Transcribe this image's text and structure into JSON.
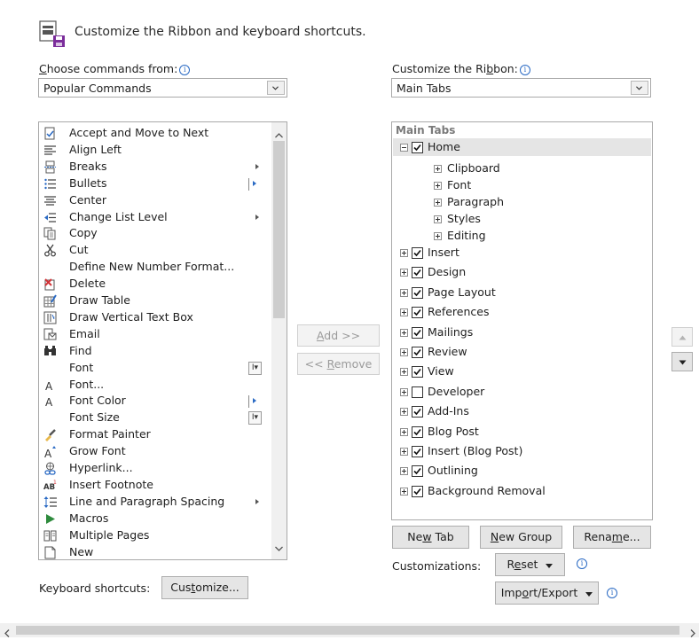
{
  "header": {
    "title": "Customize the Ribbon and keyboard shortcuts.",
    "icon": "ribbon-save-icon"
  },
  "left": {
    "choose_label_first": "C",
    "choose_label_rest": "hoose commands from:",
    "combo_value": "Popular Commands",
    "commands": [
      {
        "label": "Accept and Move to Next",
        "icon": "accept-icon"
      },
      {
        "label": "Align Left",
        "icon": "align-left-icon"
      },
      {
        "label": "Breaks",
        "icon": "breaks-icon",
        "submenu": true
      },
      {
        "label": "Bullets",
        "icon": "bullets-icon",
        "split": true
      },
      {
        "label": "Center",
        "icon": "center-icon"
      },
      {
        "label": "Change List Level",
        "icon": "change-list-level-icon",
        "submenu": true
      },
      {
        "label": "Copy",
        "icon": "copy-icon"
      },
      {
        "label": "Cut",
        "icon": "cut-icon"
      },
      {
        "label": "Define New Number Format...",
        "icon": ""
      },
      {
        "label": "Delete",
        "icon": "delete-icon"
      },
      {
        "label": "Draw Table",
        "icon": "draw-table-icon"
      },
      {
        "label": "Draw Vertical Text Box",
        "icon": "vertical-text-box-icon"
      },
      {
        "label": "Email",
        "icon": "email-icon"
      },
      {
        "label": "Find",
        "icon": "find-icon"
      },
      {
        "label": "Font",
        "icon": "",
        "fontsel": true
      },
      {
        "label": "Font...",
        "icon": "font-dialog-icon"
      },
      {
        "label": "Font Color",
        "icon": "font-color-icon",
        "split": true
      },
      {
        "label": "Font Size",
        "icon": "",
        "fontsel": true
      },
      {
        "label": "Format Painter",
        "icon": "format-painter-icon"
      },
      {
        "label": "Grow Font",
        "icon": "grow-font-icon"
      },
      {
        "label": "Hyperlink...",
        "icon": "hyperlink-icon"
      },
      {
        "label": "Insert Footnote",
        "icon": "footnote-icon"
      },
      {
        "label": "Line and Paragraph Spacing",
        "icon": "line-spacing-icon",
        "submenu": true
      },
      {
        "label": "Macros",
        "icon": "macros-icon"
      },
      {
        "label": "Multiple Pages",
        "icon": "multiple-pages-icon"
      },
      {
        "label": "New",
        "icon": "new-document-icon"
      }
    ],
    "keyboard_label": "Keyboard shortcuts:",
    "customize_button_pre": "Cus",
    "customize_button_u": "t",
    "customize_button_post": "omize..."
  },
  "middle": {
    "add_u": "A",
    "add_rest": "dd >>",
    "remove_pre": "<< ",
    "remove_u": "R",
    "remove_rest": "emove"
  },
  "right": {
    "customize_label_pre": "Customize the Ri",
    "customize_label_u": "b",
    "customize_label_post": "bon:",
    "combo_value": "Main Tabs",
    "tree_header": "Main Tabs",
    "home": {
      "label": "Home",
      "checked": true,
      "expanded": true
    },
    "home_groups": [
      "Clipboard",
      "Font",
      "Paragraph",
      "Styles",
      "Editing"
    ],
    "tabs": [
      {
        "label": "Insert",
        "checked": true
      },
      {
        "label": "Design",
        "checked": true
      },
      {
        "label": "Page Layout",
        "checked": true
      },
      {
        "label": "References",
        "checked": true
      },
      {
        "label": "Mailings",
        "checked": true
      },
      {
        "label": "Review",
        "checked": true
      },
      {
        "label": "View",
        "checked": true
      },
      {
        "label": "Developer",
        "checked": false
      },
      {
        "label": "Add-Ins",
        "checked": true
      },
      {
        "label": "Blog Post",
        "checked": true
      },
      {
        "label": "Insert (Blog Post)",
        "checked": true
      },
      {
        "label": "Outlining",
        "checked": true
      },
      {
        "label": "Background Removal",
        "checked": true
      }
    ],
    "new_tab_pre": "Ne",
    "new_tab_u": "w",
    "new_tab_post": " Tab",
    "new_group_u": "N",
    "new_group_post": "ew Group",
    "rename_pre": "Rena",
    "rename_u": "m",
    "rename_post": "e...",
    "customizations_label": "Customizations:",
    "reset_pre": "R",
    "reset_u": "e",
    "reset_post": "set",
    "import_pre": "Imp",
    "import_u": "o",
    "import_post": "rt/Export"
  },
  "colors": {
    "accent": "#2a6ac4",
    "selected_row": "#e5e5e5"
  }
}
